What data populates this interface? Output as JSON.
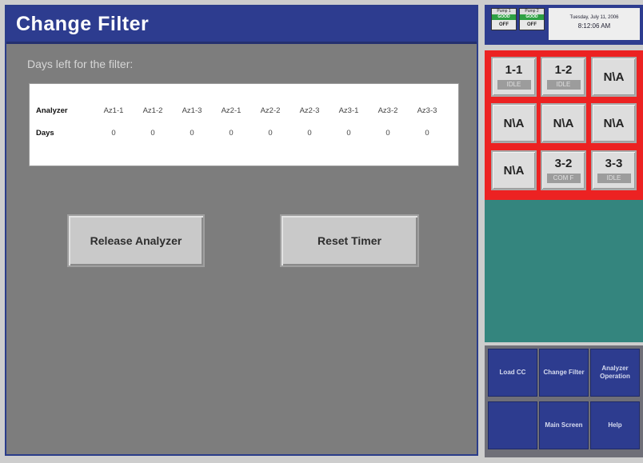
{
  "header": {
    "title": "Change Filter"
  },
  "caption": "Days left for the filter:",
  "table": {
    "row_labels": {
      "analyzer": "Analyzer",
      "days": "Days"
    },
    "analyzers": [
      "Az1-1",
      "Az1-2",
      "Az1-3",
      "Az2-1",
      "Az2-2",
      "Az2-3",
      "Az3-1",
      "Az3-2",
      "Az3-3"
    ],
    "days": [
      "0",
      "0",
      "0",
      "0",
      "0",
      "0",
      "0",
      "0",
      "0"
    ]
  },
  "buttons": {
    "release": "Release Analyzer",
    "reset": "Reset Timer"
  },
  "status": {
    "pump1": {
      "name": "Pump 1",
      "state": "GOOD",
      "power": "OFF"
    },
    "pump2": {
      "name": "Pump 2",
      "state": "GOOD",
      "power": "OFF"
    },
    "date": "Tuesday, July 11, 2006",
    "time": "8:12:06 AM"
  },
  "analyzer_grid": [
    {
      "name": "1-1",
      "state": "IDLE"
    },
    {
      "name": "1-2",
      "state": "IDLE"
    },
    {
      "name": "N\\A",
      "state": ""
    },
    {
      "name": "N\\A",
      "state": ""
    },
    {
      "name": "N\\A",
      "state": ""
    },
    {
      "name": "N\\A",
      "state": ""
    },
    {
      "name": "N\\A",
      "state": ""
    },
    {
      "name": "3-2",
      "state": "COM F"
    },
    {
      "name": "3-3",
      "state": "IDLE"
    }
  ],
  "nav": {
    "load_cc": "Load CC",
    "change_filter": "Change Filter",
    "analyzer_operation": "Analyzer Operation",
    "main_screen": "Main Screen",
    "help": "Help"
  },
  "colors": {
    "title_bar": "#2d3c8f",
    "panel": "#7d7d7d",
    "highlight_frame": "#ec2222",
    "teal": "#34857e",
    "good": "#2ea043"
  }
}
